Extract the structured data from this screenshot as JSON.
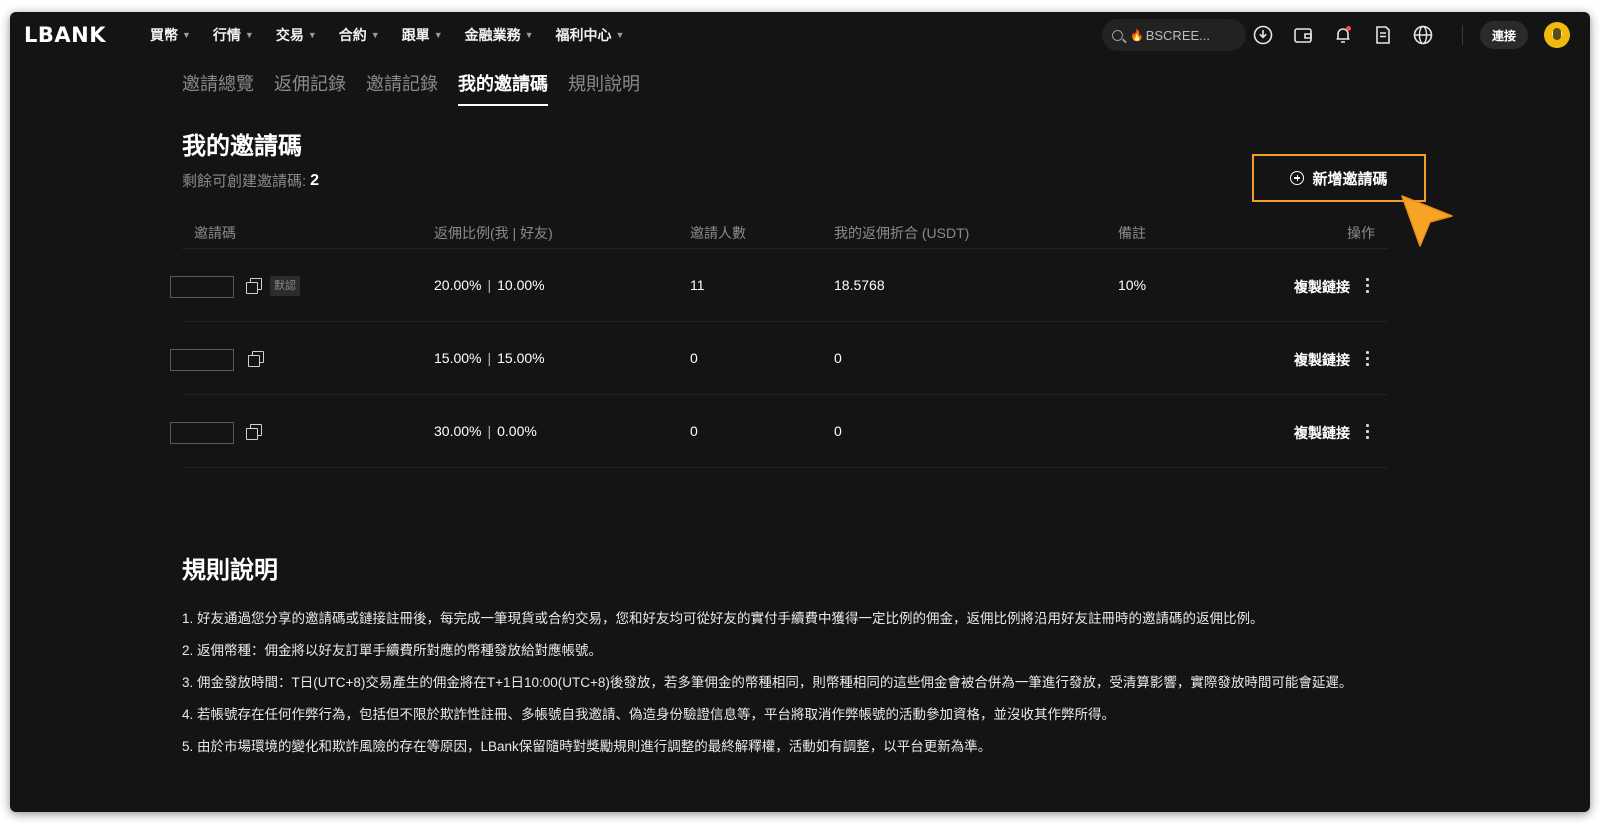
{
  "header": {
    "logo": "LBANK",
    "menu": [
      "買幣",
      "行情",
      "交易",
      "合約",
      "跟單",
      "金融業務",
      "福利中心"
    ],
    "search_placeholder": "BSCREE...",
    "connect_label": "連接"
  },
  "tabs": [
    {
      "label": "邀請總覽",
      "active": false
    },
    {
      "label": "返佣記錄",
      "active": false
    },
    {
      "label": "邀請記錄",
      "active": false
    },
    {
      "label": "我的邀請碼",
      "active": true
    },
    {
      "label": "規則說明",
      "active": false
    }
  ],
  "main": {
    "title": "我的邀請碼",
    "remaining_label": "剩餘可創建邀請碼:",
    "remaining_count": "2",
    "new_button": "新增邀請碼"
  },
  "table": {
    "columns": [
      "邀請碼",
      "返佣比例(我 | 好友)",
      "邀請人數",
      "我的返佣折合 (USDT)",
      "備註",
      "操作"
    ],
    "rows": [
      {
        "me": "20.00%",
        "friend": "10.00%",
        "invited": "11",
        "commission": "18.5768",
        "note": "10%",
        "default_tag": "默認",
        "action": "複製鏈接"
      },
      {
        "me": "15.00%",
        "friend": "15.00%",
        "invited": "0",
        "commission": "0",
        "note": "",
        "default_tag": "",
        "action": "複製鏈接"
      },
      {
        "me": "30.00%",
        "friend": "0.00%",
        "invited": "0",
        "commission": "0",
        "note": "",
        "default_tag": "",
        "action": "複製鏈接"
      }
    ]
  },
  "rules": {
    "title": "規則說明",
    "items": [
      "好友通過您分享的邀請碼或鏈接註冊後，每完成一筆現貨或合約交易，您和好友均可從好友的實付手續費中獲得一定比例的佣金，返佣比例將沿用好友註冊時的邀請碼的返佣比例。",
      "返佣幣種：佣金將以好友訂單手續費所對應的幣種發放給對應帳號。",
      "佣金發放時間：T日(UTC+8)交易產生的佣金將在T+1日10:00(UTC+8)後發放，若多筆佣金的幣種相同，則幣種相同的這些佣金會被合併為一筆進行發放，受清算影響，實際發放時間可能會延遲。",
      "若帳號存在任何作弊行為，包括但不限於欺詐性註冊、多帳號自我邀請、偽造身份驗證信息等，平台將取消作弊帳號的活動參加資格，並沒收其作弊所得。",
      "由於市場環境的變化和欺詐風險的存在等原因，LBank保留隨時對獎勵規則進行調整的最終解釋權，活動如有調整，以平台更新為準。"
    ]
  },
  "colors": {
    "background": "#141414",
    "highlight": "#f39c2a",
    "muted": "#8a8a8a"
  }
}
